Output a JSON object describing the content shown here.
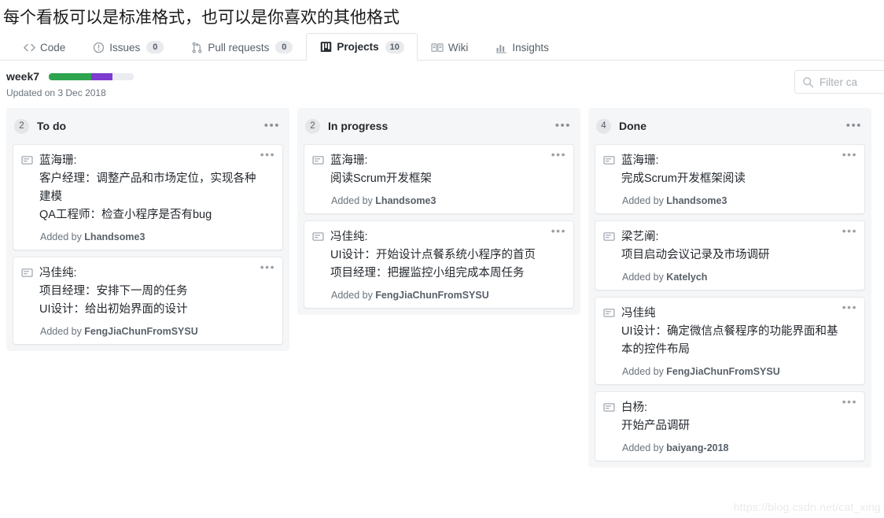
{
  "caption": "每个看板可以是标准格式，也可以是你喜欢的其他格式",
  "nav": {
    "items": [
      {
        "label": "Code",
        "icon": "code-icon",
        "count": null,
        "selected": false
      },
      {
        "label": "Issues",
        "icon": "issue-opened-icon",
        "count": "0",
        "selected": false
      },
      {
        "label": "Pull requests",
        "icon": "git-pull-request-icon",
        "count": "0",
        "selected": false
      },
      {
        "label": "Projects",
        "icon": "project-board-icon",
        "count": "10",
        "selected": true
      },
      {
        "label": "Wiki",
        "icon": "book-icon",
        "count": null,
        "selected": false
      },
      {
        "label": "Insights",
        "icon": "graph-icon",
        "count": null,
        "selected": false
      }
    ]
  },
  "project": {
    "title": "week7",
    "updated": "Updated on 3 Dec 2018",
    "progress": {
      "green_pct": 50,
      "purple_pct": 25,
      "gray_pct": 25,
      "green_color": "#2ea44f",
      "purple_color": "#7e3bd0",
      "gray_color": "#eaecef"
    },
    "filter": {
      "placeholder": "Filter ca",
      "icon": "search-icon"
    }
  },
  "columns": [
    {
      "name": "To do",
      "count": "2",
      "menu": "•••",
      "cards": [
        {
          "icon": "note-icon",
          "menu": "•••",
          "lines": [
            "蓝海珊:",
            "客户经理：调整产品和市场定位，实现各种建模",
            "QA工程师：检查小程序是否有bug"
          ],
          "added_prefix": "Added by ",
          "added_by": "Lhandsome3"
        },
        {
          "icon": "note-icon",
          "menu": "•••",
          "lines": [
            "冯佳纯:",
            "项目经理：安排下一周的任务",
            "UI设计：给出初始界面的设计"
          ],
          "added_prefix": "Added by ",
          "added_by": "FengJiaChunFromSYSU"
        }
      ]
    },
    {
      "name": "In progress",
      "count": "2",
      "menu": "•••",
      "cards": [
        {
          "icon": "note-icon",
          "menu": "•••",
          "lines": [
            "蓝海珊:",
            "阅读Scrum开发框架"
          ],
          "added_prefix": "Added by ",
          "added_by": "Lhandsome3"
        },
        {
          "icon": "note-icon",
          "menu": "•••",
          "lines": [
            "冯佳纯:",
            "UI设计：开始设计点餐系统小程序的首页",
            "项目经理：把握监控小组完成本周任务"
          ],
          "added_prefix": "Added by ",
          "added_by": "FengJiaChunFromSYSU"
        }
      ]
    },
    {
      "name": "Done",
      "count": "4",
      "menu": "•••",
      "cards": [
        {
          "icon": "note-icon",
          "menu": "•••",
          "lines": [
            "蓝海珊:",
            "完成Scrum开发框架阅读"
          ],
          "added_prefix": "Added by ",
          "added_by": "Lhandsome3"
        },
        {
          "icon": "note-icon",
          "menu": "•••",
          "lines": [
            "梁艺阐:",
            "项目启动会议记录及市场调研"
          ],
          "added_prefix": "Added by ",
          "added_by": "Katelych"
        },
        {
          "icon": "note-icon",
          "menu": "•••",
          "lines": [
            "冯佳纯",
            "UI设计：确定微信点餐程序的功能界面和基本的控件布局"
          ],
          "added_prefix": "Added by ",
          "added_by": "FengJiaChunFromSYSU"
        },
        {
          "icon": "note-icon",
          "menu": "•••",
          "lines": [
            "白杨:",
            "开始产品调研"
          ],
          "added_prefix": "Added by ",
          "added_by": "baiyang-2018"
        }
      ]
    }
  ],
  "watermark": "https://blog.csdn.net/cat_xing"
}
